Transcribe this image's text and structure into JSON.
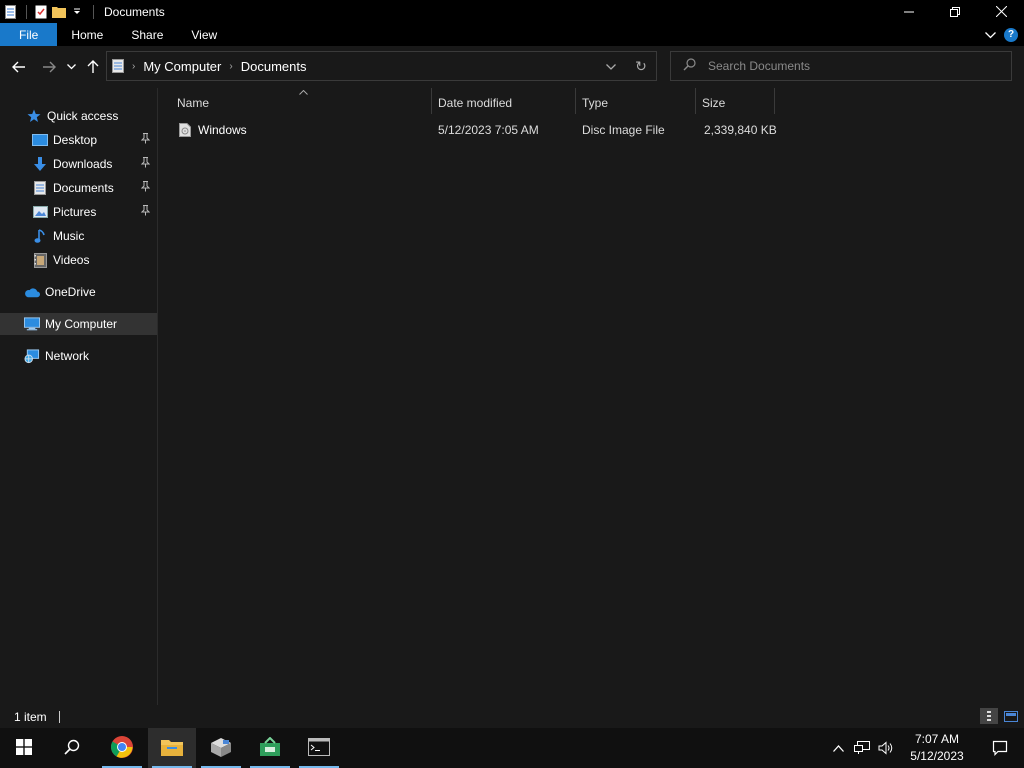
{
  "window": {
    "title": "Documents",
    "controls": {
      "minimize": "—",
      "maximize": "❐",
      "close": "✕"
    }
  },
  "ribbon": {
    "tabs": [
      {
        "label": "File"
      },
      {
        "label": "Home"
      },
      {
        "label": "Share"
      },
      {
        "label": "View"
      }
    ],
    "expand_icon": "⌄",
    "help_icon": "?"
  },
  "navigation": {
    "back": "←",
    "forward": "→",
    "recent": "⌄",
    "up": "↑"
  },
  "address_bar": {
    "crumbs": [
      "My Computer",
      "Documents"
    ],
    "dropdown": "⌄",
    "refresh": "↻"
  },
  "search": {
    "placeholder": "Search Documents",
    "value": ""
  },
  "sidebar": {
    "items": [
      {
        "label": "Quick access",
        "icon": "star-icon",
        "pinned": false
      },
      {
        "label": "Desktop",
        "icon": "desktop-icon",
        "pinned": true
      },
      {
        "label": "Downloads",
        "icon": "downloads-icon",
        "pinned": true
      },
      {
        "label": "Documents",
        "icon": "documents-icon",
        "pinned": true
      },
      {
        "label": "Pictures",
        "icon": "pictures-icon",
        "pinned": true
      },
      {
        "label": "Music",
        "icon": "music-icon",
        "pinned": false
      },
      {
        "label": "Videos",
        "icon": "videos-icon",
        "pinned": false
      },
      {
        "label": "OneDrive",
        "icon": "cloud-icon",
        "pinned": false
      },
      {
        "label": "My Computer",
        "icon": "computer-icon",
        "pinned": false,
        "selected": true
      },
      {
        "label": "Network",
        "icon": "network-icon",
        "pinned": false
      }
    ],
    "pin_glyph": "📌"
  },
  "file_list": {
    "columns": [
      "Name",
      "Date modified",
      "Type",
      "Size"
    ],
    "sort_glyph": "⌃",
    "rows": [
      {
        "name": "Windows",
        "date_modified": "5/12/2023 7:05 AM",
        "type": "Disc Image File",
        "size": "2,339,840 KB",
        "icon": "disc-image-icon"
      }
    ]
  },
  "status_bar": {
    "item_count": "1 item"
  },
  "taskbar": {
    "apps": [
      {
        "name": "start",
        "icon": "windows-logo-icon"
      },
      {
        "name": "search",
        "icon": "search-icon"
      },
      {
        "name": "chrome",
        "icon": "chrome-icon"
      },
      {
        "name": "file-explorer",
        "icon": "folder-icon",
        "active": true
      },
      {
        "name": "app-installer",
        "icon": "package-icon"
      },
      {
        "name": "app-green",
        "icon": "green-app-icon"
      },
      {
        "name": "terminal",
        "icon": "terminal-icon"
      }
    ],
    "clock": {
      "time": "7:07 AM",
      "date": "5/12/2023"
    }
  },
  "colors": {
    "accent": "#1979ca",
    "background": "#191919",
    "titlebar": "#000000",
    "taskbar": "#101010",
    "selected": "#333333"
  }
}
